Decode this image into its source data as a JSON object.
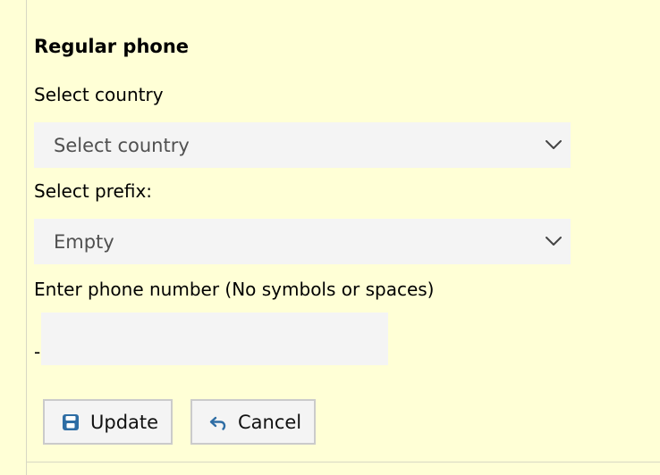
{
  "form": {
    "section_title": "Regular phone",
    "country_label": "Select country",
    "country_select": {
      "selected": "Select country"
    },
    "prefix_label": "Select prefix:",
    "prefix_select": {
      "selected": "Empty"
    },
    "phone_label": "Enter phone number (No symbols or spaces)",
    "phone_separator": "-",
    "phone_input": {
      "value": "",
      "placeholder": ""
    }
  },
  "buttons": {
    "update_label": "Update",
    "update_icon": "save-icon",
    "cancel_label": "Cancel",
    "cancel_icon": "undo-icon"
  },
  "colors": {
    "background": "#ffffd6",
    "field_background": "#f4f4f4",
    "icon_blue": "#2e6da4"
  }
}
